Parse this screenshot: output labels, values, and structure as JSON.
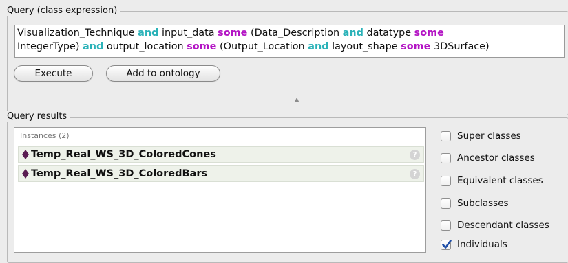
{
  "query_section": {
    "title": "Query (class expression)",
    "expression_line1": [
      {
        "text": "Visualization_Technique ",
        "kind": "plain"
      },
      {
        "text": "and",
        "kind": "and"
      },
      {
        "text": " input_data ",
        "kind": "plain"
      },
      {
        "text": "some",
        "kind": "some"
      },
      {
        "text": " (Data_Description ",
        "kind": "plain"
      },
      {
        "text": "and",
        "kind": "and"
      },
      {
        "text": " datatype ",
        "kind": "plain"
      },
      {
        "text": "some",
        "kind": "some"
      }
    ],
    "expression_line2": [
      {
        "text": "IntegerType) ",
        "kind": "plain"
      },
      {
        "text": "and",
        "kind": "and"
      },
      {
        "text": " output_location ",
        "kind": "plain"
      },
      {
        "text": "some",
        "kind": "some"
      },
      {
        "text": " (Output_Location ",
        "kind": "plain"
      },
      {
        "text": "and",
        "kind": "and"
      },
      {
        "text": " layout_shape ",
        "kind": "plain"
      },
      {
        "text": "some",
        "kind": "some"
      },
      {
        "text": " 3DSurface)",
        "kind": "plain"
      }
    ],
    "execute_label": "Execute",
    "add_label": "Add to ontology"
  },
  "results_section": {
    "title": "Query results",
    "list_header": "Instances (2)",
    "instances": [
      {
        "label": "Temp_Real_WS_3D_ColoredCones"
      },
      {
        "label": "Temp_Real_WS_3D_ColoredBars"
      }
    ],
    "help_glyph": "?",
    "options": [
      {
        "label": "Super classes",
        "checked": false
      },
      {
        "label": "Ancestor classes",
        "checked": false
      },
      {
        "label": "Equivalent classes",
        "checked": false
      },
      {
        "label": "Subclasses",
        "checked": false
      },
      {
        "label": "Descendant classes",
        "checked": false
      },
      {
        "label": "Individuals",
        "checked": true
      }
    ]
  },
  "colors": {
    "keyword_and": "#2ab2b8",
    "keyword_some": "#b314c4",
    "individual_diamond": "#5a1c52",
    "checkbox_check": "#1f4fa8"
  }
}
